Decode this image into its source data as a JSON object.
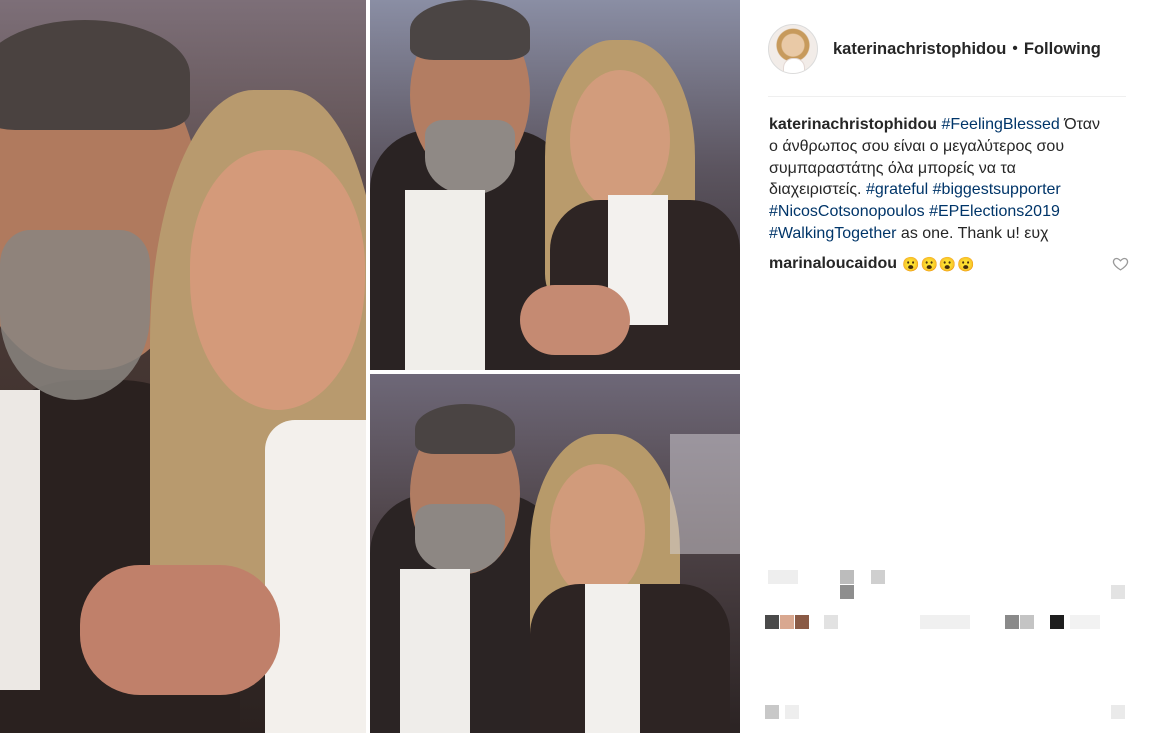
{
  "post": {
    "header": {
      "username": "katerinachristophidou",
      "separator": "•",
      "follow_status": "Following"
    },
    "caption": {
      "username": "katerinachristophidou",
      "line1": {
        "tag1": "#FeelingBlessed",
        "text1": " Όταν"
      },
      "line2": "ο άνθρωπος σου είναι ο μεγαλύτερος σου",
      "line3": "συμπαραστάτης όλα μπορείς να τα",
      "line4": {
        "text1": "διαχειριστείς. ",
        "tag1": "#grateful",
        "text2": " ",
        "tag2": "#biggestsupporter"
      },
      "line5": {
        "tag1": "#NicosCotsonopoulos",
        "text1": " ",
        "tag2": "#EPElections2019"
      },
      "line6": {
        "tag1": "#WalkingTogether",
        "text1": " as one. Thank u! ευχ"
      }
    },
    "comments": [
      {
        "username": "marinaloucaidou",
        "emojis": "😮😮😮😮"
      }
    ],
    "icons": {
      "avatar": "profile-avatar",
      "heart": "heart-outline-icon"
    },
    "colors": {
      "hashtag": "#003569",
      "text": "#262626",
      "divider": "#efefef"
    }
  }
}
